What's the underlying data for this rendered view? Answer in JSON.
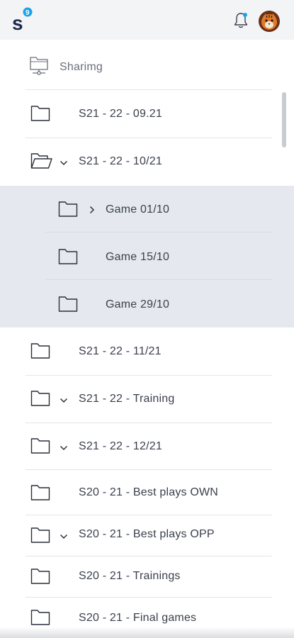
{
  "header": {
    "logo_letter": "s",
    "logo_badge": "9",
    "notification_icon": "bell-icon",
    "avatar_icon": "tiger-avatar"
  },
  "tree": {
    "root": {
      "label": "Sharimg",
      "icon": "shared-folder-icon"
    },
    "items": [
      {
        "label": "S21 - 22  - 09.21",
        "icon": "folder-icon",
        "chevron": "none"
      },
      {
        "label": "S21 - 22  - 10/21",
        "icon": "folder-open-icon",
        "chevron": "down"
      },
      {
        "label": "Game 01/10",
        "icon": "folder-icon",
        "chevron": "right",
        "selected": true
      },
      {
        "label": "Game 15/10",
        "icon": "folder-icon",
        "chevron": "none",
        "selected": true
      },
      {
        "label": "Game 29/10",
        "icon": "folder-icon",
        "chevron": "none",
        "selected": true
      },
      {
        "label": "S21 - 22  - 11/21",
        "icon": "folder-icon",
        "chevron": "none"
      },
      {
        "label": "S21 - 22  - Training",
        "icon": "folder-icon",
        "chevron": "down"
      },
      {
        "label": "S21 - 22  - 12/21",
        "icon": "folder-icon",
        "chevron": "down"
      },
      {
        "label": "S20 - 21  - Best plays OWN",
        "icon": "folder-icon",
        "chevron": "none"
      },
      {
        "label": "S20 - 21  - Best plays OPP",
        "icon": "folder-icon",
        "chevron": "down"
      },
      {
        "label": "S20 - 21  - Trainings",
        "icon": "folder-icon",
        "chevron": "none"
      },
      {
        "label": "S20 - 21  - Final games",
        "icon": "folder-icon",
        "chevron": "none"
      }
    ]
  },
  "colors": {
    "selection_bg": "#e5e9ef",
    "logo_navy": "#1e2a4a",
    "badge_blue": "#1aa3e8"
  }
}
